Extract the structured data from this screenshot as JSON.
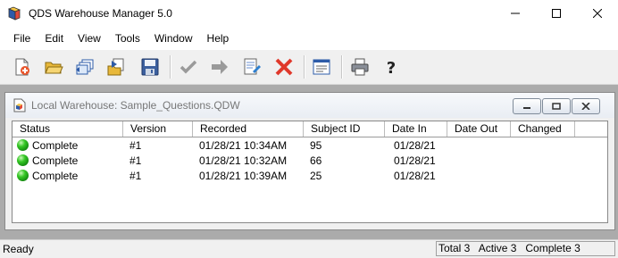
{
  "window": {
    "title": "QDS Warehouse Manager 5.0"
  },
  "menu": [
    "File",
    "Edit",
    "View",
    "Tools",
    "Window",
    "Help"
  ],
  "toolbar": {
    "buttons": [
      {
        "name": "new-icon"
      },
      {
        "name": "open-folder-icon"
      },
      {
        "name": "windows-icon"
      },
      {
        "name": "import-icon"
      },
      {
        "name": "save-icon"
      },
      {
        "name": "check-icon"
      },
      {
        "name": "arrow-right-icon"
      },
      {
        "name": "edit-document-icon"
      },
      {
        "name": "delete-x-icon"
      },
      {
        "name": "form-view-icon"
      },
      {
        "name": "print-icon"
      },
      {
        "name": "help-icon"
      }
    ]
  },
  "document": {
    "title": "Local Warehouse:  Sample_Questions.QDW"
  },
  "table": {
    "columns": [
      "Status",
      "Version",
      "Recorded",
      "Subject ID",
      "Date In",
      "Date Out",
      "Changed"
    ],
    "rows": [
      {
        "status": "Complete",
        "version": "#1",
        "recorded": "01/28/21 10:34AM",
        "subject_id": "95",
        "date_in": "01/28/21",
        "date_out": "",
        "changed": ""
      },
      {
        "status": "Complete",
        "version": "#1",
        "recorded": "01/28/21 10:32AM",
        "subject_id": "66",
        "date_in": "01/28/21",
        "date_out": "",
        "changed": ""
      },
      {
        "status": "Complete",
        "version": "#1",
        "recorded": "01/28/21 10:39AM",
        "subject_id": "25",
        "date_in": "01/28/21",
        "date_out": "",
        "changed": ""
      }
    ]
  },
  "statusbar": {
    "ready": "Ready",
    "counts": "Total 3   Active 3   Complete 3"
  }
}
